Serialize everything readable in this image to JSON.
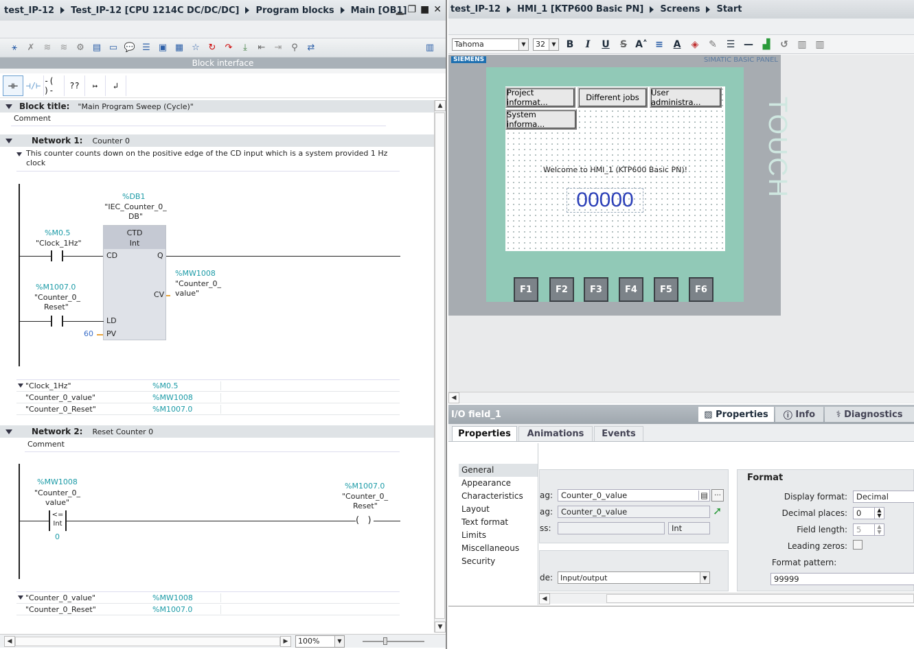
{
  "left": {
    "breadcrumb": [
      "test_IP-12",
      "Test_IP-12 [CPU 1214C DC/DC/DC]",
      "Program blocks",
      "Main [OB1]"
    ],
    "block_interface": "Block interface",
    "ladder_tools": [
      "⊣⊢",
      "⊣/⊢",
      "-( )-",
      "??",
      "↦",
      "↲"
    ],
    "block_title_label": "Block title:",
    "block_title_value": "\"Main Program Sweep (Cycle)\"",
    "block_comment": "Comment",
    "network1": {
      "label": "Network 1:",
      "title": "Counter 0",
      "comment": "This counter counts down on the positive edge of the CD input which is a system provided 1 Hz clock",
      "db_addr": "%DB1",
      "db_name1": "\"IEC_Counter_0_",
      "db_name2": "DB\"",
      "box_type": "CTD",
      "box_dtype": "Int",
      "pin_cd": "CD",
      "pin_q": "Q",
      "pin_cv": "CV",
      "pin_ld": "LD",
      "pin_pv": "PV",
      "pv_value": "60",
      "c1_addr": "%M0.5",
      "c1_name": "\"Clock_1Hz\"",
      "c2_addr": "%M1007.0",
      "c2_name1": "\"Counter_0_",
      "c2_name2": "Reset\"",
      "cv_addr": "%MW1008",
      "cv_name1": "\"Counter_0_",
      "cv_name2": "value\"",
      "tags": [
        {
          "name": "\"Clock_1Hz\"",
          "addr": "%M0.5"
        },
        {
          "name": "\"Counter_0_value\"",
          "addr": "%MW1008"
        },
        {
          "name": "\"Counter_0_Reset\"",
          "addr": "%M1007.0"
        }
      ]
    },
    "network2": {
      "label": "Network 2:",
      "title": "Reset Counter 0",
      "comment": "Comment",
      "cmp_addr": "%MW1008",
      "cmp_name1": "\"Counter_0_",
      "cmp_name2": "value\"",
      "cmp_op": "<=",
      "cmp_type": "Int",
      "cmp_value": "0",
      "coil_addr": "%M1007.0",
      "coil_name1": "\"Counter_0_",
      "coil_name2": "Reset\"",
      "tags": [
        {
          "name": "\"Counter_0_value\"",
          "addr": "%MW1008"
        },
        {
          "name": "\"Counter_0_Reset\"",
          "addr": "%M1007.0"
        }
      ]
    },
    "zoom": "100%"
  },
  "right": {
    "breadcrumb": [
      "test_IP-12",
      "HMI_1 [KTP600 Basic PN]",
      "Screens",
      "Start"
    ],
    "font_name": "Tahoma",
    "font_size": "32",
    "panel_brand": "SIEMENS",
    "panel_model": "SIMATIC BASIC PANEL",
    "panel_touch": "TOUCH",
    "buttons": [
      "Project informat...",
      "Different jobs",
      "User administra...",
      "System informa..."
    ],
    "welcome": "Welcome to HMI_1 (KTP600 Basic PN)!",
    "io_value": "00000",
    "fkeys": [
      "F1",
      "F2",
      "F3",
      "F4",
      "F5",
      "F6"
    ],
    "inspector_title": "I/O field_1",
    "inspector_tabs": [
      "Properties",
      "Info",
      "Diagnostics"
    ],
    "sub_tabs": [
      "Properties",
      "Animations",
      "Events"
    ],
    "nav": [
      "General",
      "Appearance",
      "Characteristics",
      "Layout",
      "Text format",
      "Limits",
      "Miscellaneous",
      "Security"
    ],
    "process": {
      "tag_label": "ag:",
      "tag_value": "Counter_0_value",
      "plc_tag_label": "ag:",
      "plc_tag_value": "Counter_0_value",
      "address_label": "ss:",
      "address_type": "Int",
      "mode_label": "de:",
      "mode_value": "Input/output"
    },
    "format": {
      "title": "Format",
      "display_format_label": "Display format:",
      "display_format_value": "Decimal",
      "decimal_places_label": "Decimal places:",
      "decimal_places_value": "0",
      "field_length_label": "Field length:",
      "field_length_value": "5",
      "leading_zeros_label": "Leading zeros:",
      "format_pattern_label": "Format pattern:",
      "format_pattern_value": "99999"
    }
  }
}
